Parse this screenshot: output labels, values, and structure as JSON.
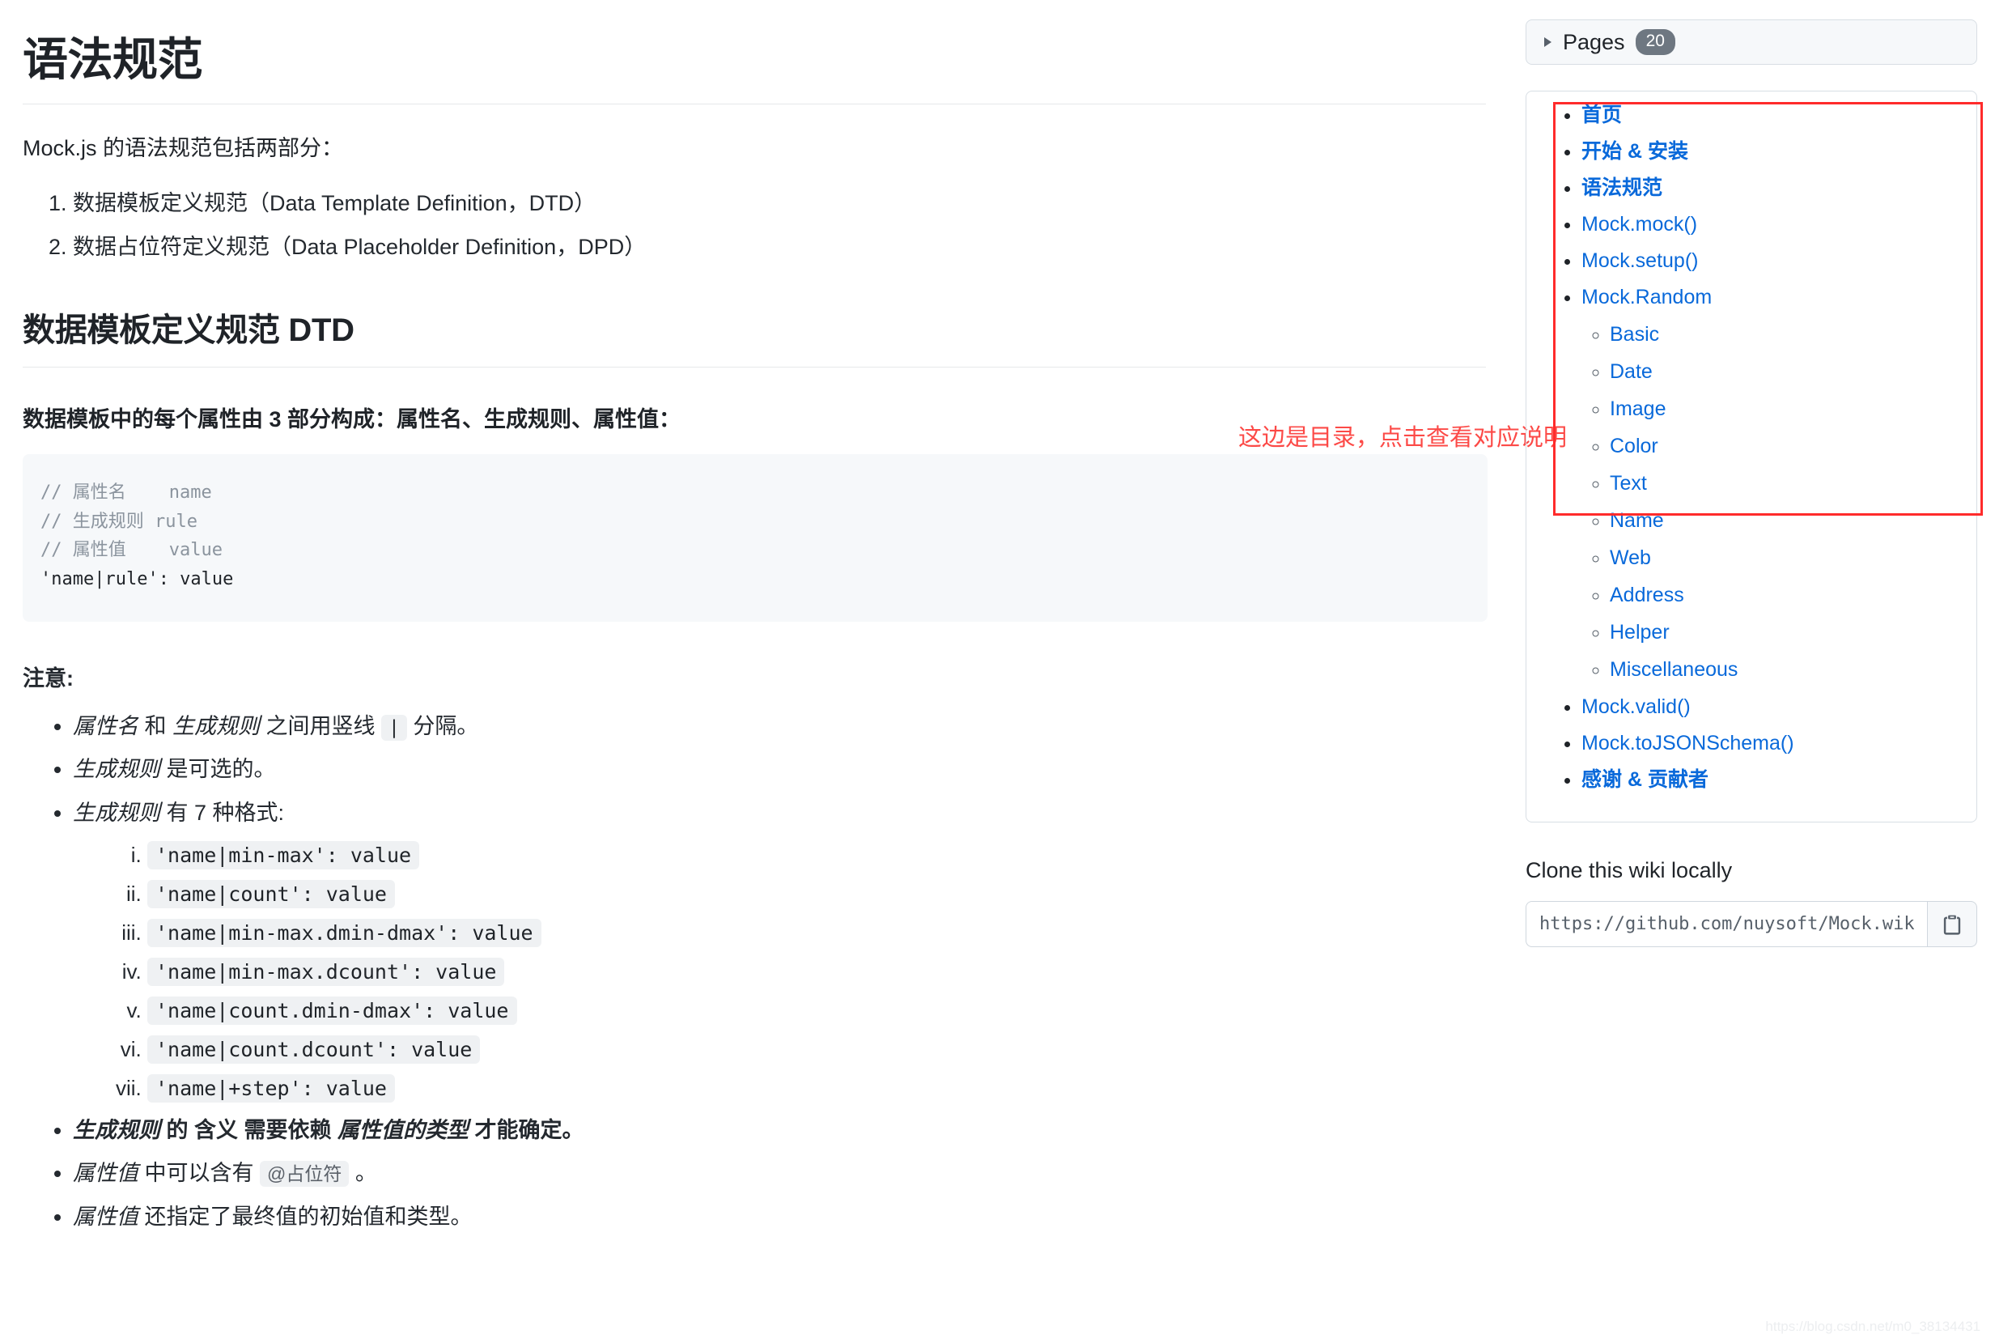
{
  "main": {
    "title": "语法规范",
    "intro": "Mock.js 的语法规范包括两部分：",
    "top_list": [
      "数据模板定义规范（Data Template Definition，DTD）",
      "数据占位符定义规范（Data Placeholder Definition，DPD）"
    ],
    "section_heading": "数据模板定义规范 DTD",
    "sub_heading": "数据模板中的每个属性由 3 部分构成：属性名、生成规则、属性值：",
    "code_block": {
      "line1_comment": "// 属性名    name",
      "line2_comment": "// 生成规则 rule",
      "line3_comment": "// 属性值    value",
      "line4": "'name|rule': value"
    },
    "note_heading": "注意:",
    "notes": {
      "n1_a": "属性名",
      "n1_b": " 和 ",
      "n1_c": "生成规则",
      "n1_d": " 之间用竖线 ",
      "n1_code": "|",
      "n1_e": " 分隔。",
      "n2_a": "生成规则",
      "n2_b": " 是可选的。",
      "n3_a": "生成规则",
      "n3_b": " 有 7 种格式:",
      "n4_a": "生成规则",
      "n4_b": " 的 含义 需要依赖 ",
      "n4_c": "属性值的类型",
      "n4_d": " 才能确定。",
      "n5_a": "属性值",
      "n5_b": " 中可以含有 ",
      "n5_code": "@占位符",
      "n5_c": " 。",
      "n6_a": "属性值",
      "n6_b": " 还指定了最终值的初始值和类型。"
    },
    "rule_formats": [
      "'name|min-max': value",
      "'name|count': value",
      "'name|min-max.dmin-dmax': value",
      "'name|min-max.dcount': value",
      "'name|count.dmin-dmax': value",
      "'name|count.dcount': value",
      "'name|+step': value"
    ],
    "annotation": "这边是目录，点击查看对应说明"
  },
  "sidebar": {
    "pages_label": "Pages",
    "pages_count": "20",
    "nav": [
      {
        "label": "首页",
        "bold": true
      },
      {
        "label": "开始 & 安装",
        "bold": true
      },
      {
        "label": "语法规范",
        "bold": true
      },
      {
        "label": "Mock.mock()",
        "bold": false
      },
      {
        "label": "Mock.setup()",
        "bold": false
      },
      {
        "label": "Mock.Random",
        "bold": false
      }
    ],
    "subnav": [
      "Basic",
      "Date",
      "Image",
      "Color",
      "Text",
      "Name",
      "Web",
      "Address",
      "Helper",
      "Miscellaneous"
    ],
    "nav_tail": [
      {
        "label": "Mock.valid()",
        "bold": false
      },
      {
        "label": "Mock.toJSONSchema()",
        "bold": false
      }
    ],
    "nav_outside": [
      {
        "label": "感谢 & 贡献者",
        "bold": true
      }
    ],
    "clone_title": "Clone this wiki locally",
    "clone_url": "https://github.com/nuysoft/Mock.wiki.git"
  },
  "watermark": "https://blog.csdn.net/m0_38134431",
  "colors": {
    "link": "#0969da",
    "annotation": "#fc4a47",
    "redbox": "#ff2b2b",
    "badge_bg": "#6e7781"
  }
}
